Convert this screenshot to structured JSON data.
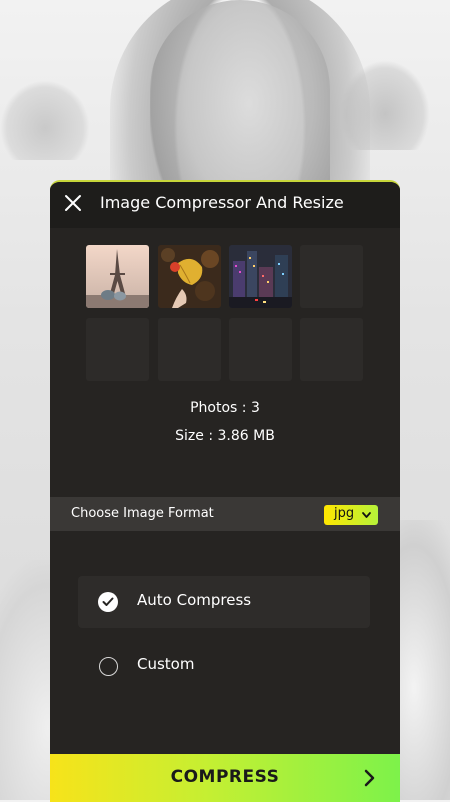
{
  "dialog": {
    "title": "Image Compressor And Resize"
  },
  "photos": {
    "thumbnails": [
      {
        "icon": "eiffel-tower-photo"
      },
      {
        "icon": "autumn-leaf-photo"
      },
      {
        "icon": "city-night-photo"
      }
    ],
    "empty_slots": 5
  },
  "stats": {
    "photos_text": "Photos : 3",
    "size_text": "Size : 3.86 MB"
  },
  "format": {
    "label": "Choose Image Format",
    "selected": "jpg"
  },
  "compression_options": {
    "auto_label": "Auto Compress",
    "custom_label": "Custom",
    "selected": "auto"
  },
  "action": {
    "compress_label": "COMPRESS"
  },
  "colors": {
    "panel_bg": "#262422",
    "accent_yellow": "#f7e31a",
    "accent_green": "#7df24a"
  }
}
